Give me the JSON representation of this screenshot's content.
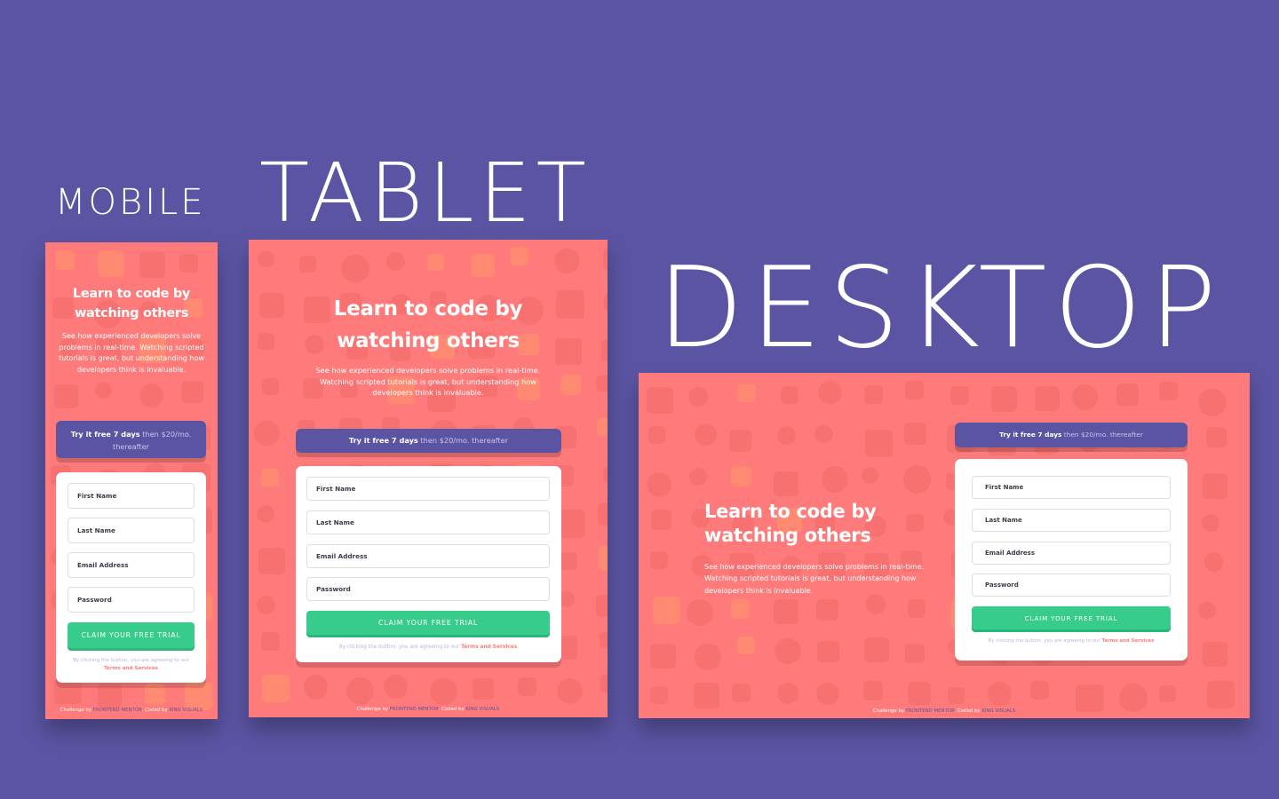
{
  "labels": {
    "mobile": "MOBILE",
    "tablet": "TABLET",
    "desktop": "DESKTOP"
  },
  "colors": {
    "background": "#5b54a3",
    "frame": "#ff7a7a",
    "accent_blue": "#5b54a3",
    "accent_green": "#38cc8c",
    "text_dark": "#3d3b48",
    "link_red": "#ff7a7a"
  },
  "hero": {
    "title_line1": "Learn to code by",
    "title_line2": "watching others",
    "text_mobile": "See how experienced developers solve problems in real-time. Watching scripted tutorials is great, but understanding how developers think is invaluable.",
    "text_tablet": "See how experienced developers solve problems in real-time. Watching scripted tutorials is great, but understanding how developers think is invaluable.",
    "text_desktop": "See how experienced developers solve problems in real-time. Watching scripted tutorials is great, but understanding how developers think is invaluable."
  },
  "promo": {
    "bold": "Try it free 7 days",
    "rest": "then $20/mo. thereafter"
  },
  "form": {
    "first_name": "First Name",
    "last_name": "Last Name",
    "email": "Email Address",
    "password": "Password",
    "cta": "CLAIM YOUR FREE TRIAL",
    "terms_prefix": "By clicking the button, you are agreeing to our",
    "terms_link": "Terms and Services"
  },
  "attribution": {
    "challenge_prefix": "Challenge by",
    "challenge_link": "FRONTEND MENTOR",
    "coded_prefix": ". Coded by",
    "coded_link": "KING VISUALS"
  }
}
